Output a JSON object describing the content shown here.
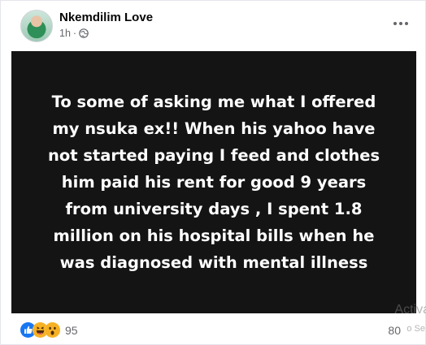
{
  "post": {
    "author": "Nkemdilim Love",
    "time": "1h",
    "separator": "·",
    "privacy_icon": "globe-icon",
    "more_icon": "more-options-icon",
    "text": "To some of asking me what I offered my nsuka ex!! When his yahoo have not started paying I feed and clothes him paid his rent for good 9 years from university days , I spent 1.8 million on his hospital bills when he was diagnosed with mental illness",
    "background_color": "#141414",
    "text_color": "#ffffff"
  },
  "footer": {
    "reaction_icons": [
      "like-icon",
      "haha-icon",
      "wow-icon"
    ],
    "reaction_count": "95",
    "comment_count": "80"
  },
  "watermark": {
    "title": "Activa",
    "subtitle": "o Se"
  },
  "colors": {
    "like": "#1877f2",
    "haha": "#f7b125",
    "meta": "#65676b"
  }
}
